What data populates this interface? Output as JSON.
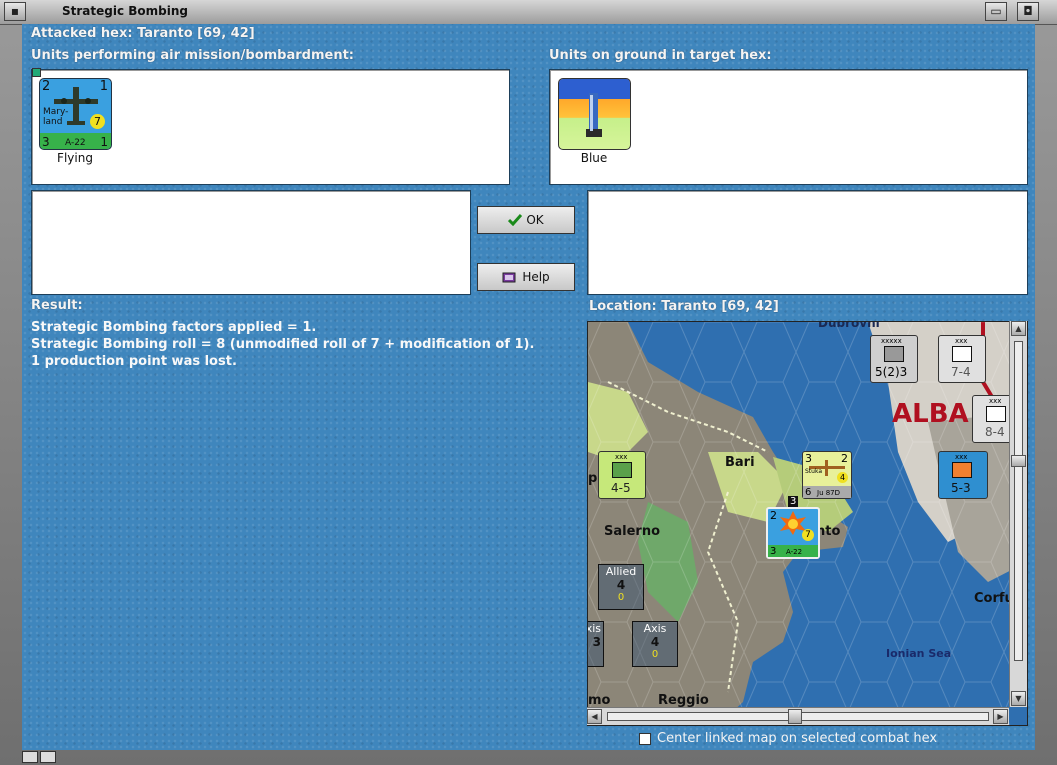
{
  "window": {
    "title": "Strategic Bombing"
  },
  "header": {
    "attacked_hex": "Attacked hex: Taranto  [69, 42]"
  },
  "air_units": {
    "label": "Units performing air mission/bombardment:",
    "unit": {
      "top_left": "2",
      "top_right": "1",
      "name": "Mary-\nland",
      "name_line1": "Mary-",
      "name_line2": "land",
      "circle": "7",
      "bottom_left": "3",
      "bottom_mid": "A-22",
      "bottom_right": "1",
      "caption": "Flying"
    }
  },
  "ground_units": {
    "label": "Units on ground in target hex:",
    "unit": {
      "caption": "Blue"
    }
  },
  "buttons": {
    "ok": "OK",
    "help": "Help"
  },
  "result": {
    "label": "Result:",
    "lines": [
      "Strategic Bombing factors applied = 1.",
      "Strategic Bombing roll = 8 (unmodified roll of 7 + modification of 1).",
      "1 production point was lost."
    ]
  },
  "location": {
    "label": "Location:  Taranto  [69, 42]"
  },
  "map": {
    "places": {
      "bari": "Bari",
      "salerno": "Salerno",
      "taranto": "nto",
      "corfu": "Corfu",
      "ionian": "Ionian Sea",
      "reggio": "Reggio",
      "alba": "ALBA",
      "dubrovnik": "Dubrovni",
      "mo": "mo",
      "pl": "pl"
    },
    "counters": {
      "c1": {
        "top": "xxxxx",
        "bottom": "5(2)3"
      },
      "c2": {
        "top": "xxx",
        "bottom": "7-4"
      },
      "c3": {
        "top": "xxx",
        "bottom": "8-4"
      },
      "c4": {
        "top": "xxx",
        "bottom": "4-5"
      },
      "c5": {
        "top_left": "3",
        "top_right": "2",
        "circle": "4",
        "bottom_left": "6",
        "bottom_mid": "Ju 87D",
        "name": "Stuka"
      },
      "c6": {
        "top": "xxx",
        "bottom": "5-3"
      },
      "c7": {
        "top_left": "2",
        "circle": "7",
        "bottom_left": "3",
        "bottom_mid": "A-22",
        "stack": "3"
      }
    },
    "stats": {
      "allied": {
        "title": "Allied",
        "value": "4",
        "sub": "0"
      },
      "axis": {
        "title": "Axis",
        "value": "4",
        "sub": "0"
      },
      "axis_partial": {
        "title": "xis",
        "value": "3"
      }
    }
  },
  "footer": {
    "center_checkbox_label": "Center linked map on selected combat hex"
  },
  "colors": {
    "client_bg": "#3f86bd",
    "sea": "#2f6fb0",
    "land_green": "#c8d88a",
    "axis_red": "#b01020"
  }
}
